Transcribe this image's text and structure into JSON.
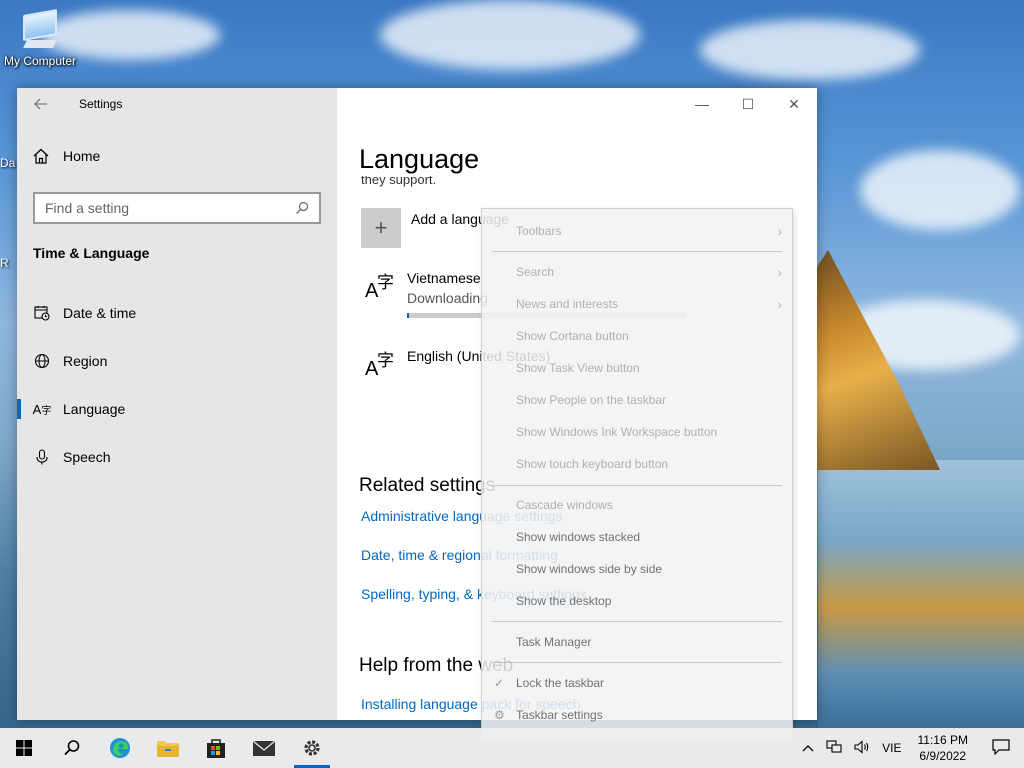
{
  "desktop": {
    "icon_label": "My Computer",
    "edge_label_1": "Da",
    "edge_label_2": "R"
  },
  "window": {
    "title": "Settings",
    "controls": {
      "minimize": "—",
      "maximize": "☐",
      "close": "✕"
    }
  },
  "sidebar": {
    "home": "Home",
    "search_placeholder": "Find a setting",
    "section": "Time & Language",
    "items": [
      {
        "label": "Date & time",
        "icon": "calendar-clock-icon"
      },
      {
        "label": "Region",
        "icon": "globe-icon"
      },
      {
        "label": "Language",
        "icon": "language-icon",
        "active": true
      },
      {
        "label": "Speech",
        "icon": "microphone-icon"
      }
    ]
  },
  "content": {
    "title": "Language",
    "cut_text": "they support.",
    "add_language": "Add a language",
    "languages": [
      {
        "name": "Vietnamese",
        "status": "Downloading",
        "progress": 0.0
      },
      {
        "name": "English (United States)"
      }
    ],
    "related_heading": "Related settings",
    "related_links": [
      "Administrative language settings",
      "Date, time & regional formatting",
      "Spelling, typing, & keyboard settings"
    ],
    "help_heading": "Help from the web",
    "help_links": [
      "Installing language pack for speech"
    ]
  },
  "context_menu": {
    "items": [
      {
        "label": "Toolbars",
        "submenu": true
      },
      {
        "label": "Search",
        "submenu": true
      },
      {
        "label": "News and interests",
        "submenu": true
      },
      {
        "label": "Show Cortana button"
      },
      {
        "label": "Show Task View button"
      },
      {
        "label": "Show People on the taskbar"
      },
      {
        "label": "Show Windows Ink Workspace button"
      },
      {
        "label": "Show touch keyboard button"
      },
      {
        "label": "Cascade windows"
      },
      {
        "label": "Show windows stacked"
      },
      {
        "label": "Show windows side by side"
      },
      {
        "label": "Show the desktop"
      },
      {
        "label": "Task Manager"
      },
      {
        "label": "Lock the taskbar",
        "checked": true
      },
      {
        "label": "Taskbar settings"
      }
    ]
  },
  "taskbar": {
    "input_language": "VIE",
    "time": "11:16 PM",
    "date": "6/9/2022"
  },
  "colors": {
    "accent": "#0067c0",
    "sidebar": "#e6e6e6",
    "taskbar": "#eeeef0"
  }
}
